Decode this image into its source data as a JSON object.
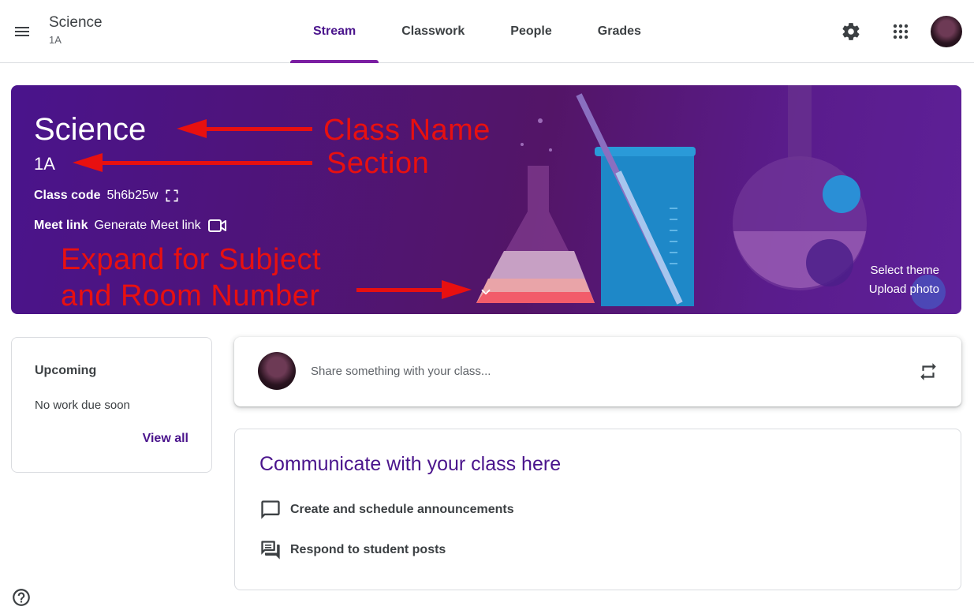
{
  "header": {
    "class_title": "Science",
    "class_section": "1A",
    "tabs": [
      {
        "label": "Stream"
      },
      {
        "label": "Classwork"
      },
      {
        "label": "People"
      },
      {
        "label": "Grades"
      }
    ],
    "active_tab": "Stream"
  },
  "banner": {
    "title": "Science",
    "section": "1A",
    "class_code_label": "Class code",
    "class_code_value": "5h6b25w",
    "meet_label": "Meet link",
    "meet_value": "Generate Meet link",
    "select_theme": "Select theme",
    "upload_photo": "Upload photo"
  },
  "annotations": {
    "class_name": "Class Name",
    "section": "Section",
    "expand_line1": "Expand for Subject",
    "expand_line2": "and Room Number"
  },
  "upcoming": {
    "heading": "Upcoming",
    "empty": "No work due soon",
    "view_all": "View all"
  },
  "share": {
    "placeholder": "Share something with your class..."
  },
  "communicate": {
    "heading": "Communicate with your class here",
    "items": [
      {
        "label": "Create and schedule announcements",
        "icon": "announcement-icon"
      },
      {
        "label": "Respond to student posts",
        "icon": "student-posts-icon"
      }
    ]
  },
  "colors": {
    "accent": "#4a148c",
    "tab_indicator": "#7b1fa2",
    "annotation": "#e81010",
    "banner_bg": "#531567"
  }
}
